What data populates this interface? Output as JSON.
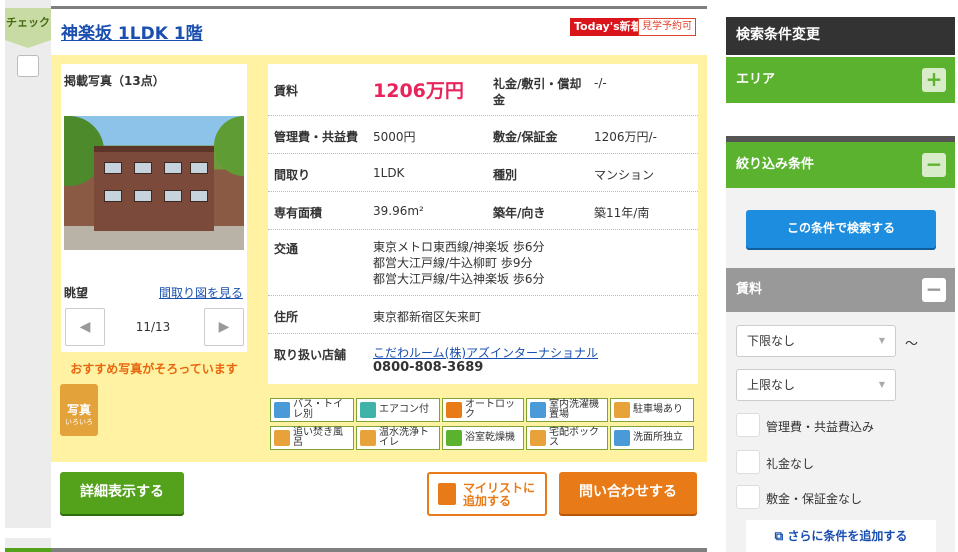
{
  "check_tab": "チェック",
  "listing": {
    "title": "神楽坂 1LDK 1階",
    "badge_new": "Today's新着",
    "badge_visit": "見学予約可",
    "photos_label": "掲載写真（13点）",
    "view_label": "眺望",
    "floorplan_link": "間取り図を見る",
    "photo_counter": "11/13",
    "recommend_text": "おすすめ写真がそろっています",
    "photo_icon_main": "写真",
    "photo_icon_sub": "いろいろ"
  },
  "details": {
    "rent_label": "賃料",
    "rent_value": "1206万円",
    "deposit_label": "礼金/敷引・償却金",
    "deposit_value": "-/-",
    "mgmt_label": "管理費・共益費",
    "mgmt_value": "5000円",
    "shikikin_label": "敷金/保証金",
    "shikikin_value": "1206万円/-",
    "layout_label": "間取り",
    "layout_value": "1LDK",
    "type_label": "種別",
    "type_value": "マンション",
    "area_label": "専有面積",
    "area_value": "39.96m²",
    "age_label": "築年/向き",
    "age_value": "築11年/南",
    "access_label": "交通",
    "access_lines": [
      "東京メトロ東西線/神楽坂 歩6分",
      "都営大江戸線/牛込柳町 歩9分",
      "都営大江戸線/牛込神楽坂 歩6分"
    ],
    "address_label": "住所",
    "address_value": "東京都新宿区矢来町",
    "agent_label": "取り扱い店舗",
    "agent_name": "こだわルーム(株)アズインターナショナル",
    "agent_phone": "0800-808-3689"
  },
  "features": [
    "バス・トイレ別",
    "エアコン付",
    "オートロック",
    "室内洗濯機置場",
    "駐車場あり",
    "追い焚き風呂",
    "温水洗浄トイレ",
    "浴室乾燥機",
    "宅配ボックス",
    "洗面所独立"
  ],
  "buttons": {
    "detail": "詳細表示する",
    "mylist": "マイリストに追加する",
    "inquiry": "問い合わせする"
  },
  "sidebar": {
    "header": "検索条件変更",
    "area": "エリア",
    "refine": "絞り込み条件",
    "search_button": "この条件で検索する",
    "rent_section": "賃料",
    "min_select": "下限なし",
    "max_select": "上限なし",
    "tilde": "～",
    "options": [
      "管理費・共益費込み",
      "礼金なし",
      "敷金・保証金なし"
    ],
    "add_condition": "さらに条件を追加する"
  },
  "colors": {
    "green": "#5ab22f",
    "orange": "#e87a18",
    "blue": "#1d8de0",
    "rent_pink": "#e8245a"
  }
}
